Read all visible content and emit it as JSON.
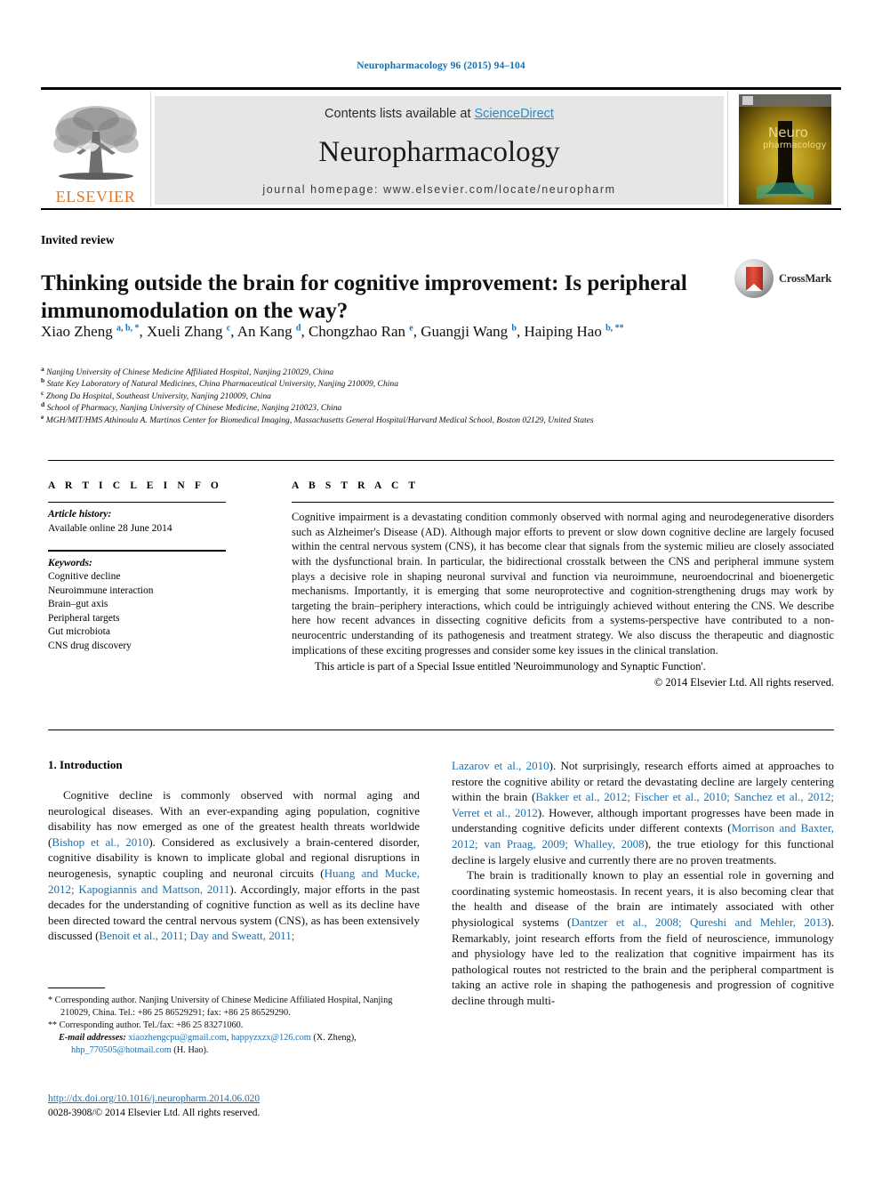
{
  "running_head": "Neuropharmacology 96 (2015) 94–104",
  "masthead": {
    "publisher_wordmark": "ELSEVIER",
    "contents_prefix": "Contents lists available at ",
    "contents_link": "ScienceDirect",
    "journal_name": "Neuropharmacology",
    "homepage": "journal homepage: www.elsevier.com/locate/neuropharm",
    "cover_title_top": "Neuro",
    "cover_title_bottom": "pharmacology"
  },
  "article": {
    "type_label": "Invited review",
    "title": "Thinking outside the brain for cognitive improvement: Is peripheral immunomodulation on the way?",
    "crossmark_label": "CrossMark",
    "authors": [
      {
        "name": "Xiao Zheng",
        "marks": "a, b, *"
      },
      {
        "name": "Xueli Zhang",
        "marks": "c"
      },
      {
        "name": "An Kang",
        "marks": "d"
      },
      {
        "name": "Chongzhao Ran",
        "marks": "e"
      },
      {
        "name": "Guangji Wang",
        "marks": "b"
      },
      {
        "name": "Haiping Hao",
        "marks": "b, **"
      }
    ],
    "affiliations": [
      {
        "mark": "a",
        "text": "Nanjing University of Chinese Medicine Affiliated Hospital, Nanjing 210029, China"
      },
      {
        "mark": "b",
        "text": "State Key Laboratory of Natural Medicines, China Pharmaceutical University, Nanjing 210009, China"
      },
      {
        "mark": "c",
        "text": "Zhong Da Hospital, Southeast University, Nanjing 210009, China"
      },
      {
        "mark": "d",
        "text": "School of Pharmacy, Nanjing University of Chinese Medicine, Nanjing 210023, China"
      },
      {
        "mark": "e",
        "text": "MGH/MIT/HMS Athinoula A. Martinos Center for Biomedical Imaging, Massachusetts General Hospital/Harvard Medical School, Boston 02129, United States"
      }
    ]
  },
  "article_info": {
    "heading": "A R T I C L E  I N F O",
    "history_label": "Article history:",
    "history_value": "Available online 28 June 2014",
    "keywords_label": "Keywords:",
    "keywords": [
      "Cognitive decline",
      "Neuroimmune interaction",
      "Brain–gut axis",
      "Peripheral targets",
      "Gut microbiota",
      "CNS drug discovery"
    ]
  },
  "abstract": {
    "heading": "A B S T R A C T",
    "body": "Cognitive impairment is a devastating condition commonly observed with normal aging and neurodegenerative disorders such as Alzheimer's Disease (AD). Although major efforts to prevent or slow down cognitive decline are largely focused within the central nervous system (CNS), it has become clear that signals from the systemic milieu are closely associated with the dysfunctional brain. In particular, the bidirectional crosstalk between the CNS and peripheral immune system plays a decisive role in shaping neuronal survival and function via neuroimmune, neuroendocrinal and bioenergetic mechanisms. Importantly, it is emerging that some neuroprotective and cognition-strengthening drugs may work by targeting the brain–periphery interactions, which could be intriguingly achieved without entering the CNS. We describe here how recent advances in dissecting cognitive deficits from a systems-perspective have contributed to a non-neurocentric understanding of its pathogenesis and treatment strategy. We also discuss the therapeutic and diagnostic implications of these exciting progresses and consider some key issues in the clinical translation.",
    "special_issue": "This article is part of a Special Issue entitled 'Neuroimmunology and Synaptic Function'.",
    "copyright": "© 2014 Elsevier Ltd. All rights reserved."
  },
  "introduction": {
    "section_title": "1. Introduction",
    "left_para_1": {
      "t1": "Cognitive decline is commonly observed with normal aging and neurological diseases. With an ever-expanding aging population, cognitive disability has now emerged as one of the greatest health threats worldwide (",
      "r1": "Bishop et al., 2010",
      "t2": "). Considered as exclusively a brain-centered disorder, cognitive disability is known to implicate global and regional disruptions in neurogenesis, synaptic coupling and neuronal circuits (",
      "r2": "Huang and Mucke, 2012; Kapogiannis and Mattson, 2011",
      "t3": "). Accordingly, major efforts in the past decades for the understanding of cognitive function as well as its decline have been directed toward the central nervous system (CNS), as has been extensively discussed (",
      "r3": "Benoit et al., 2011; Day and Sweatt, 2011;"
    },
    "right_para_1": {
      "r0": "Lazarov et al., 2010",
      "t1": "). Not surprisingly, research efforts aimed at approaches to restore the cognitive ability or retard the devastating decline are largely centering within the brain (",
      "r1": "Bakker et al., 2012; Fischer et al., 2010; Sanchez et al., 2012; Verret et al., 2012",
      "t2": "). However, although important progresses have been made in understanding cognitive deficits under different contexts (",
      "r2": "Morrison and Baxter, 2012; van Praag, 2009; Whalley, 2008",
      "t3": "), the true etiology for this functional decline is largely elusive and currently there are no proven treatments."
    },
    "right_para_2": {
      "t1": "The brain is traditionally known to play an essential role in governing and coordinating systemic homeostasis. In recent years, it is also becoming clear that the health and disease of the brain are intimately associated with other physiological systems (",
      "r1": "Dantzer et al., 2008; Qureshi and Mehler, 2013",
      "t2": "). Remarkably, joint research efforts from the field of neuroscience, immunology and physiology have led to the realization that cognitive impairment has its pathological routes not restricted to the brain and the peripheral compartment is taking an active role in shaping the pathogenesis and progression of cognitive decline through multi-"
    }
  },
  "footnotes": {
    "fn1_mark": "*",
    "fn1": "Corresponding author. Nanjing University of Chinese Medicine Affiliated Hospital, Nanjing 210029, China. Tel.: +86 25 86529291; fax: +86 25 86529290.",
    "fn2_mark": "**",
    "fn2": "Corresponding author. Tel./fax: +86 25 83271060.",
    "email_label": "E-mail addresses:",
    "email_1": "xiaozhengcpu@gmail.com",
    "email_2": "happyzxzx@126.com",
    "email_1_owner": "(X. Zheng),",
    "email_3": "hhp_770505@hotmail.com",
    "email_3_owner": "(H. Hao)."
  },
  "doi": {
    "url": "http://dx.doi.org/10.1016/j.neuropharm.2014.06.020",
    "issn_line": "0028-3908/© 2014 Elsevier Ltd. All rights reserved."
  },
  "colors": {
    "link": "#1a6faf",
    "sciencedirect": "#2e8bc9",
    "elsevier_orange": "#e87722",
    "band_gray": "#e6e6e6"
  }
}
